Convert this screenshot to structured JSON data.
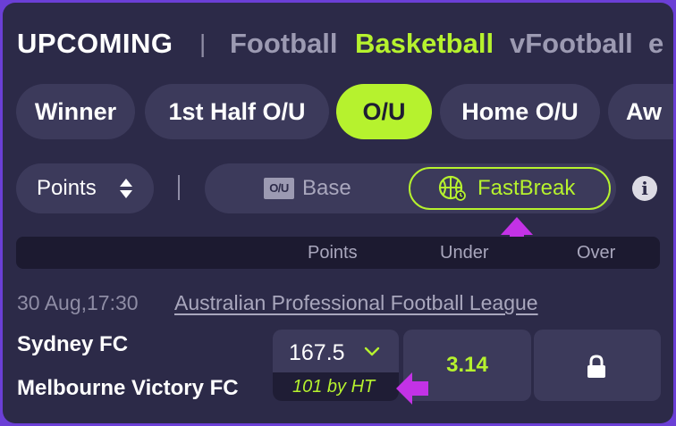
{
  "top_nav": {
    "title": "UPCOMING",
    "separator": "|",
    "tabs": [
      "Football",
      "Basketball",
      "vFootball",
      "e"
    ],
    "active_tab": "Basketball"
  },
  "market_chips": [
    "Winner",
    "1st Half O/U",
    "O/U",
    "Home O/U",
    "Aw"
  ],
  "active_chip": "O/U",
  "filter": {
    "select_value": "Points",
    "separator": "|",
    "toggle": {
      "base_icon_text": "O/U",
      "base_label": "Base",
      "fast_label": "FastBreak",
      "selected": "FastBreak"
    }
  },
  "table_header": {
    "points": "Points",
    "under": "Under",
    "over": "Over"
  },
  "match": {
    "datetime": "30 Aug,17:30",
    "league": "Australian Professional Football League",
    "home_team": "Sydney FC",
    "away_team": "Melbourne Victory FC",
    "points_line": "167.5",
    "ht_note": "101 by HT",
    "under_odds": "3.14",
    "over_locked": true
  },
  "icons": {
    "sort": "sort-updown-icon",
    "basketball": "basketball-icon",
    "info": "info-icon",
    "chevron": "chevron-down-icon",
    "lock": "lock-icon",
    "annotation_arrows": "purple-arrow-icon"
  },
  "colors": {
    "accent": "#b6f22e",
    "background": "#2c2a48",
    "chip": "#3c3a5b",
    "frame": "#6b3fd6",
    "annotation": "#c332e6"
  }
}
